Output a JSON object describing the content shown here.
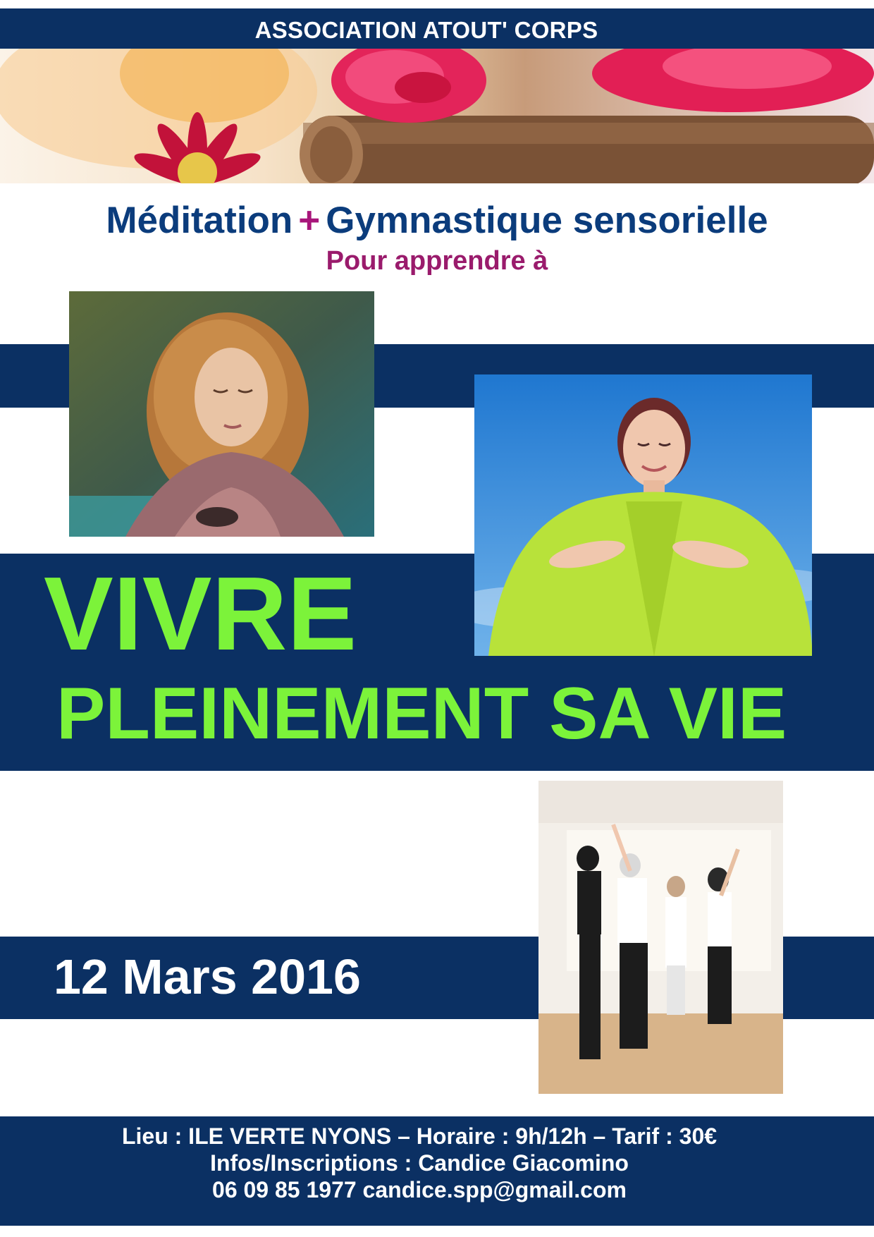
{
  "header": {
    "association": "ASSOCIATION ATOUT' CORPS"
  },
  "title": {
    "part1": "Méditation",
    "plus": "+",
    "part2": "Gymnastique sensorielle",
    "subtitle": "Pour apprendre à"
  },
  "headline": {
    "line1": "VIVRE",
    "line2": "PLEINEMENT SA VIE"
  },
  "event": {
    "date": "12 Mars 2016"
  },
  "footer": {
    "line1": "Lieu : ILE VERTE NYONS – Horaire : 9h/12h – Tarif : 30€",
    "line2": "Infos/Inscriptions : Candice Giacomino",
    "line3": "06 09 85 1977 candice.spp@gmail.com"
  },
  "colors": {
    "navy": "#0b3063",
    "title_blue": "#0b3c7c",
    "magenta": "#a8157a",
    "lime": "#7cf33a",
    "white": "#ffffff"
  }
}
